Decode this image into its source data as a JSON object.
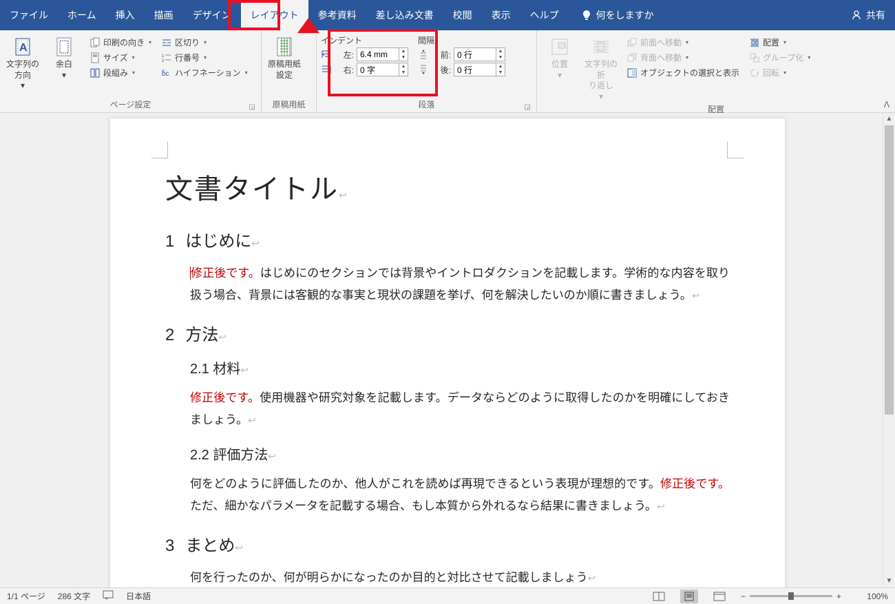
{
  "tabs": {
    "file": "ファイル",
    "home": "ホーム",
    "insert": "挿入",
    "draw": "描画",
    "design": "デザイン",
    "layout": "レイアウト",
    "references": "参考資料",
    "mailings": "差し込み文書",
    "review": "校閲",
    "view": "表示",
    "help": "ヘルプ",
    "tellme": "何をしますか",
    "share": "共有"
  },
  "ribbon": {
    "page_setup": {
      "text_direction": "文字列の\n方向",
      "margins": "余白",
      "orientation": "印刷の向き",
      "size": "サイズ",
      "columns": "段組み",
      "breaks": "区切り",
      "line_numbers": "行番号",
      "hyphenation": "ハイフネーション",
      "label": "ページ設定"
    },
    "manuscript": {
      "btn": "原稿用紙\n設定",
      "label": "原稿用紙"
    },
    "indent": {
      "title": "インデント",
      "left_label": "左:",
      "left_value": "6.4 mm",
      "right_label": "右:",
      "right_value": "0 字"
    },
    "spacing": {
      "title": "間隔",
      "before_label": "前:",
      "before_value": "0 行",
      "after_label": "後:",
      "after_value": "0 行",
      "label": "段落"
    },
    "arrange": {
      "position": "位置",
      "wrap": "文字列の折\nり返し",
      "bring_forward": "前面へ移動",
      "send_backward": "背面へ移動",
      "selection_pane": "オブジェクトの選択と表示",
      "align": "配置",
      "group": "グループ化",
      "rotate": "回転",
      "label": "配置"
    }
  },
  "document": {
    "title": "文書タイトル",
    "h1_1_num": "1",
    "h1_1": "はじめに",
    "p1_red": "修正後です。",
    "p1_rest": "はじめにのセクションでは背景やイントロダクションを記載します。学術的な内容を取り扱う場合、背景には客観的な事実と現状の課題を挙げ、何を解決したいのか順に書きましょう。",
    "h1_2_num": "2",
    "h1_2": "方法",
    "h2_21": "2.1 材料",
    "p21_red": "修正後です。",
    "p21_rest": "使用機器や研究対象を記載します。データならどのように取得したのかを明確にしておきましょう。",
    "h2_22": "2.2 評価方法",
    "p22_a": "何をどのように評価したのか、他人がこれを読めば再現できるという表現が理想的です。",
    "p22_red": "修正後です。",
    "p22_b": "ただ、細かなパラメータを記載する場合、もし本質から外れるなら結果に書きましょう。",
    "h1_3_num": "3",
    "h1_3": "まとめ",
    "p3": "何を行ったのか、何が明らかになったのか目的と対比させて記載しましょう"
  },
  "status": {
    "page": "1/1 ページ",
    "words": "286 文字",
    "lang": "日本語",
    "zoom": "100%"
  }
}
